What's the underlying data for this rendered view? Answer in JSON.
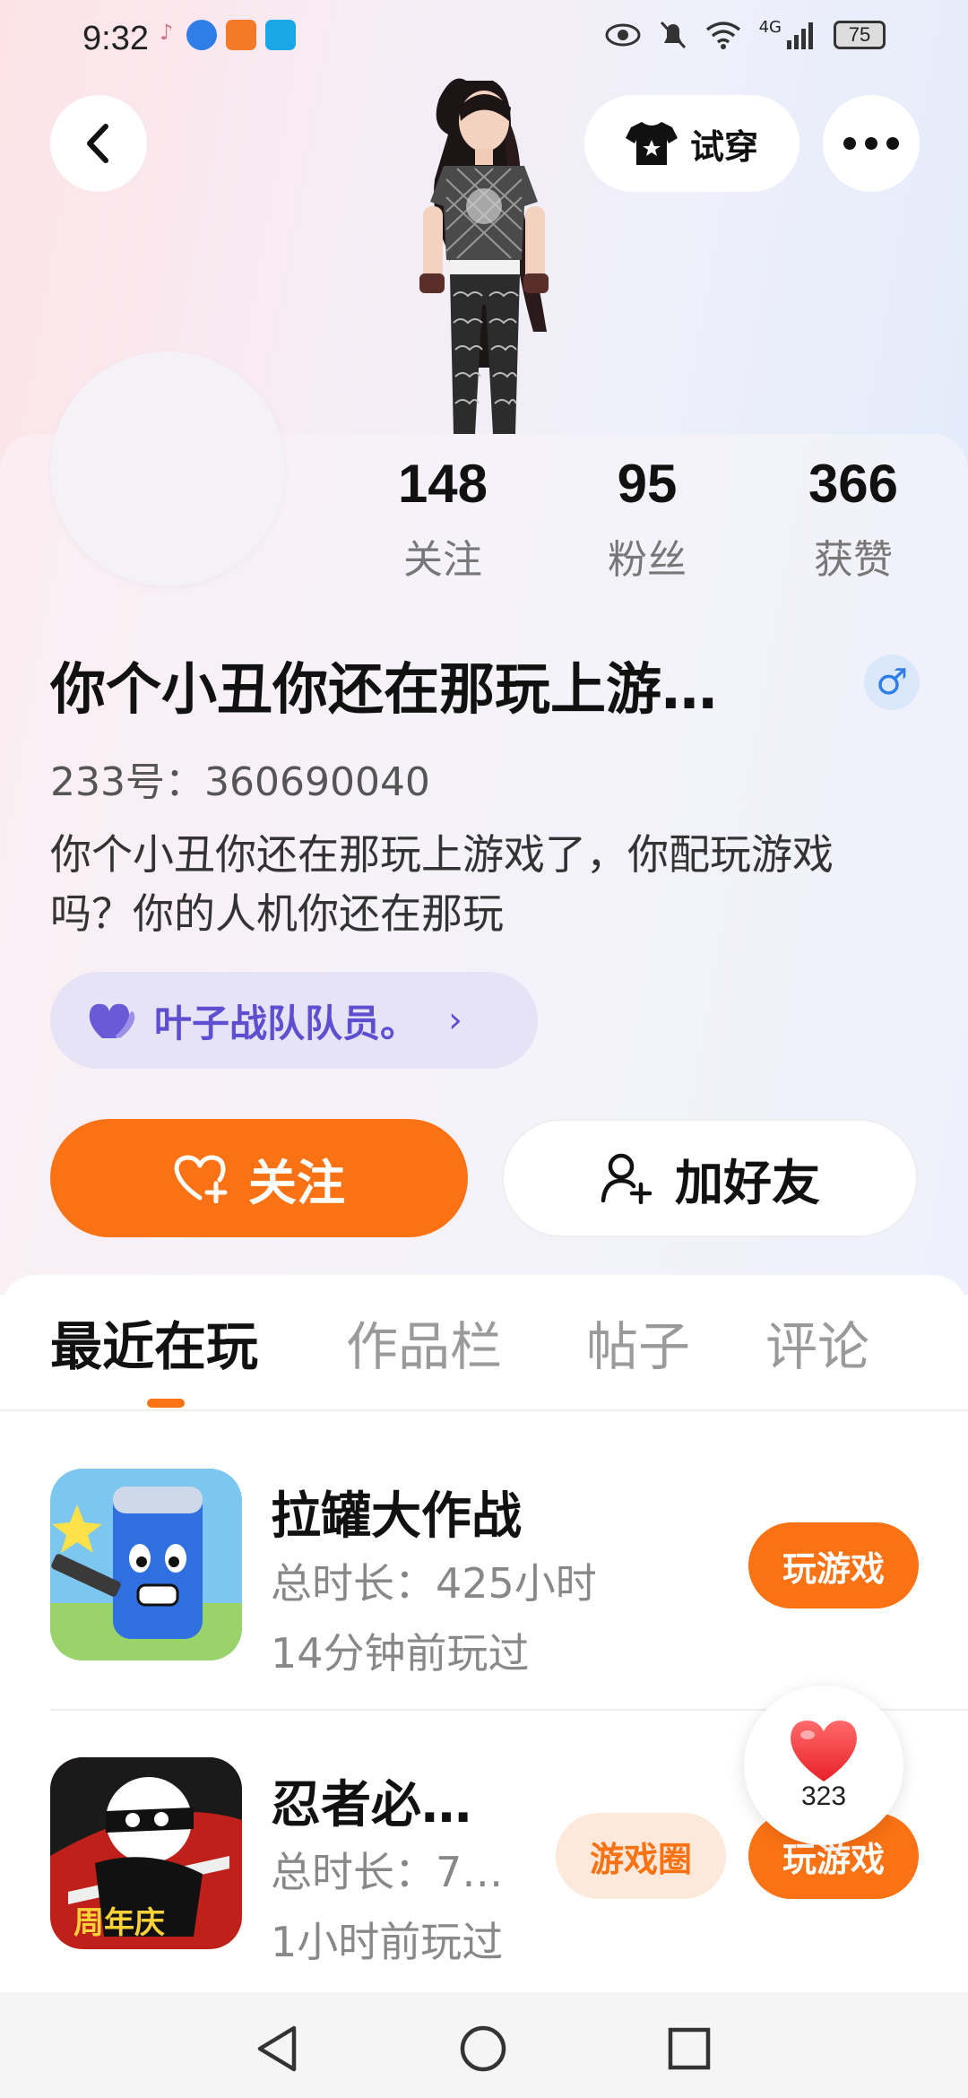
{
  "status_bar": {
    "time": "9:32",
    "network": "4G",
    "battery": "75"
  },
  "header": {
    "back_label": "back",
    "tryon_label": "试穿",
    "more_label": "more"
  },
  "stats": [
    {
      "value": "148",
      "label": "关注"
    },
    {
      "value": "95",
      "label": "粉丝"
    },
    {
      "value": "366",
      "label": "获赞"
    }
  ],
  "profile": {
    "name": "你个小丑你还在那玩上游…",
    "gender_symbol": "♂",
    "uid": "233号：360690040",
    "bio": "你个小丑你还在那玩上游戏了，你配玩游戏吗？你的人机你还在那玩",
    "team": "叶子战队队员。"
  },
  "actions": {
    "follow": "关注",
    "add_friend": "加好友"
  },
  "tabs": [
    {
      "label": "最近在玩",
      "active": true
    },
    {
      "label": "作品栏",
      "active": false
    },
    {
      "label": "帖子",
      "active": false
    },
    {
      "label": "评论",
      "active": false
    }
  ],
  "games": [
    {
      "title": "拉罐大作战",
      "duration": "总时长：425小时",
      "last_played": "14分钟前玩过",
      "play_label": "玩游戏"
    },
    {
      "title": "忍者必…",
      "duration": "总时长：7…",
      "last_played": "1小时前玩过",
      "circle_label": "游戏圈",
      "play_label": "玩游戏",
      "badge": "周年庆"
    }
  ],
  "like_widget": {
    "count": "323"
  },
  "colors": {
    "accent": "#fb7214",
    "team_text": "#5d4fcf",
    "gender": "#2f7ee8"
  },
  "icons": [
    "back-icon",
    "tshirt-icon",
    "more-icon",
    "heart-plus-icon",
    "person-add-icon",
    "heart-icon",
    "male-icon",
    "nav-back-icon",
    "nav-home-icon",
    "nav-recent-icon"
  ]
}
